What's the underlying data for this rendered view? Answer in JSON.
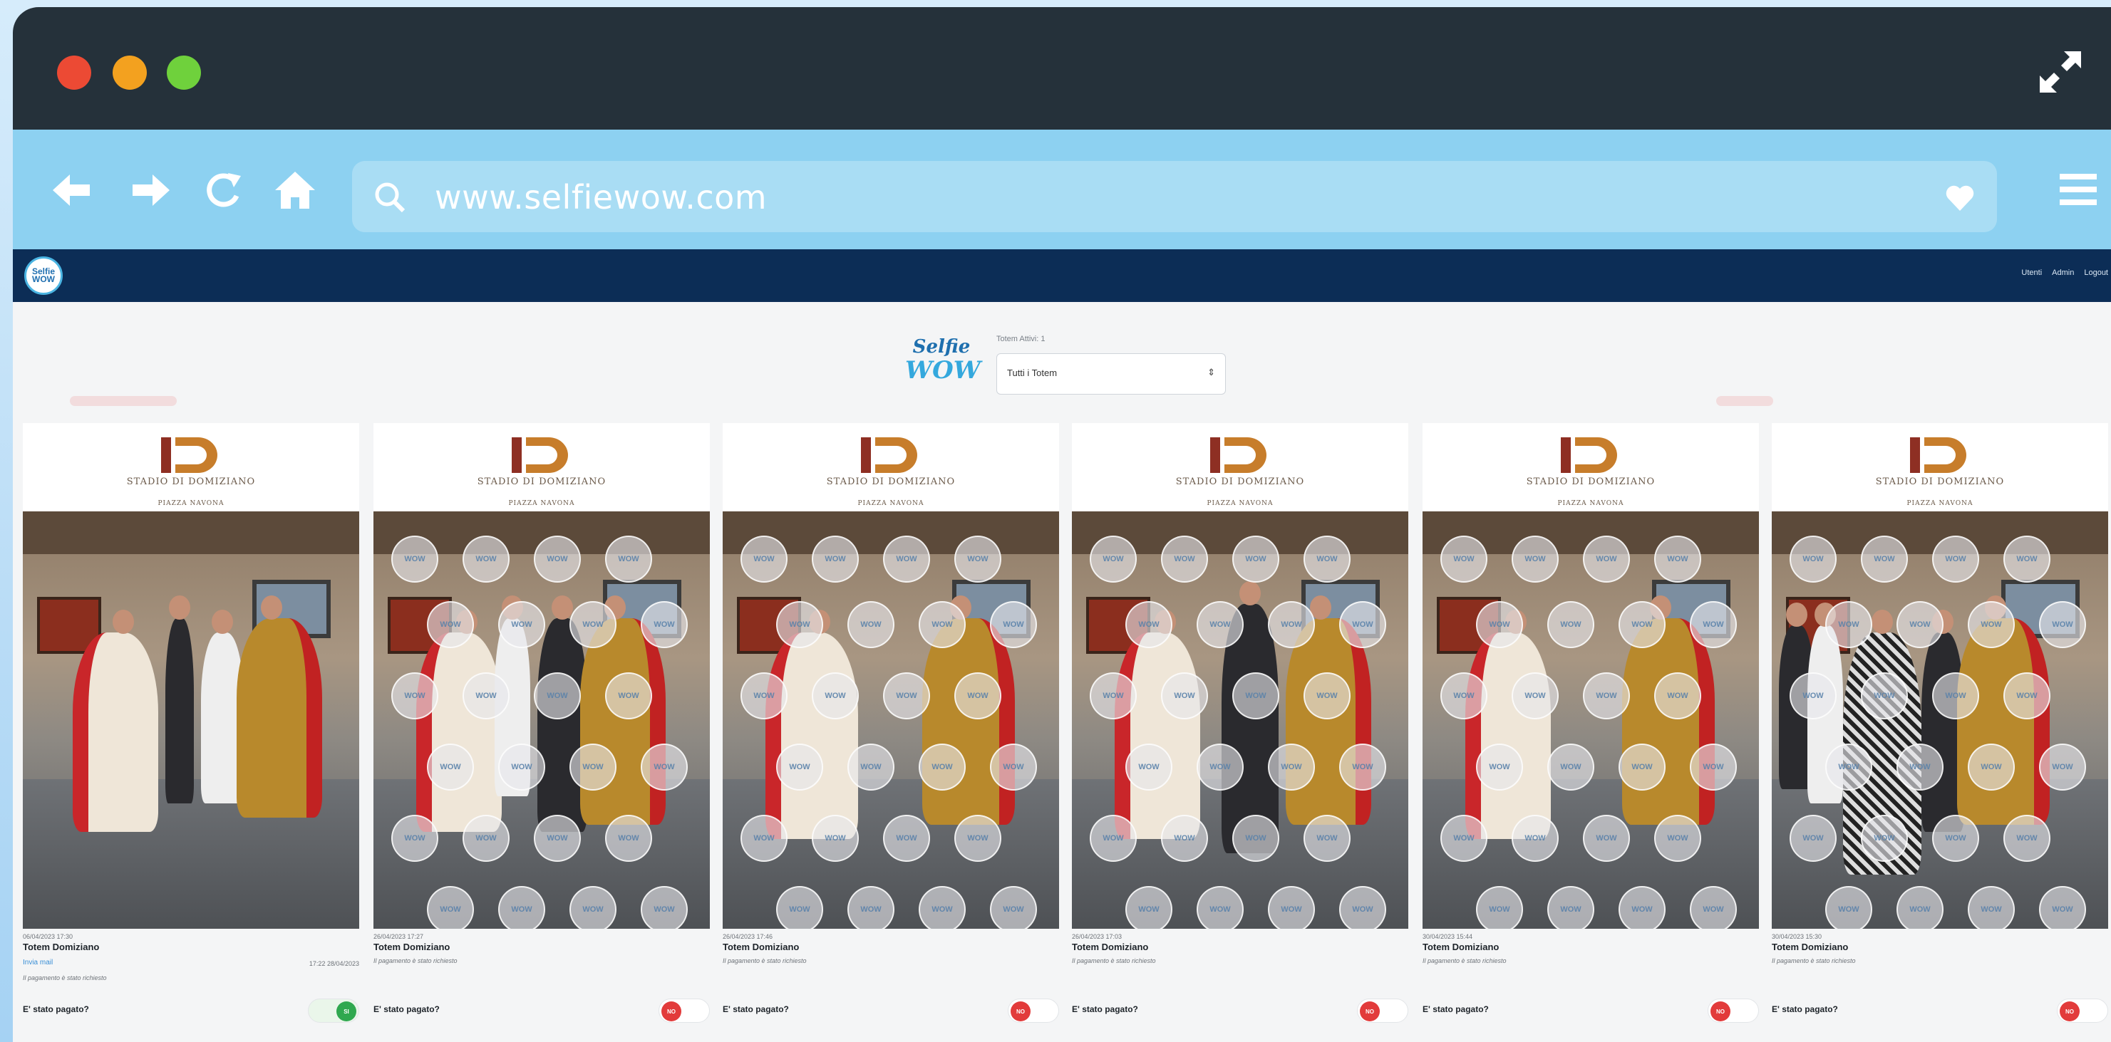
{
  "browser": {
    "url": "www.selfiewow.com"
  },
  "app": {
    "logo_text": "Selfie WOW",
    "nav": [
      "Utenti",
      "Admin",
      "Logout"
    ]
  },
  "header": {
    "brand_line1": "Selfie",
    "brand_line2": "WOW",
    "totem_label": "Totem Attivi: 1",
    "totem_select_value": "Tutti i Totem"
  },
  "cards": [
    {
      "logo_subtitle": "STADIO DI DOMIZIANO",
      "logo_caption": "PIAZZA NAVONA",
      "date": "06/04/2023 17:30",
      "name": "Totem Domiziano",
      "email_link": "Invia mail",
      "email_sent": "17:22 28/04/2023",
      "note": "Il pagamento è stato richiesto",
      "paid_label": "E' stato pagato?",
      "paid_toggle": "SI",
      "paid": true
    },
    {
      "logo_subtitle": "STADIO DI DOMIZIANO",
      "logo_caption": "PIAZZA NAVONA",
      "date": "26/04/2023 17:27",
      "name": "Totem Domiziano",
      "note": "Il pagamento è stato richiesto",
      "paid_label": "E' stato pagato?",
      "paid_toggle": "NO",
      "paid": false
    },
    {
      "logo_subtitle": "STADIO DI DOMIZIANO",
      "logo_caption": "PIAZZA NAVONA",
      "date": "26/04/2023 17:46",
      "name": "Totem Domiziano",
      "note": "Il pagamento è stato richiesto",
      "paid_label": "E' stato pagato?",
      "paid_toggle": "NO",
      "paid": false
    },
    {
      "logo_subtitle": "STADIO DI DOMIZIANO",
      "logo_caption": "PIAZZA NAVONA",
      "date": "26/04/2023 17:03",
      "name": "Totem Domiziano",
      "note": "Il pagamento è stato richiesto",
      "paid_label": "E' stato pagato?",
      "paid_toggle": "NO",
      "paid": false
    },
    {
      "logo_subtitle": "STADIO DI DOMIZIANO",
      "logo_caption": "PIAZZA NAVONA",
      "date": "30/04/2023 15:44",
      "name": "Totem Domiziano",
      "note": "Il pagamento è stato richiesto",
      "paid_label": "E' stato pagato?",
      "paid_toggle": "NO",
      "paid": false
    },
    {
      "logo_subtitle": "STADIO DI DOMIZIANO",
      "logo_caption": "PIAZZA NAVONA",
      "date": "30/04/2023 15:30",
      "name": "Totem Domiziano",
      "note": "Il pagamento è stato richiesto",
      "paid_label": "E' stato pagato?",
      "paid_toggle": "NO",
      "paid": false
    }
  ],
  "colors": {
    "titlebar": "#25313a",
    "navbar": "#8dd1f1",
    "appbar": "#0c2d56",
    "accent_paid": "#2fa84f",
    "accent_unpaid": "#e23b3b"
  }
}
